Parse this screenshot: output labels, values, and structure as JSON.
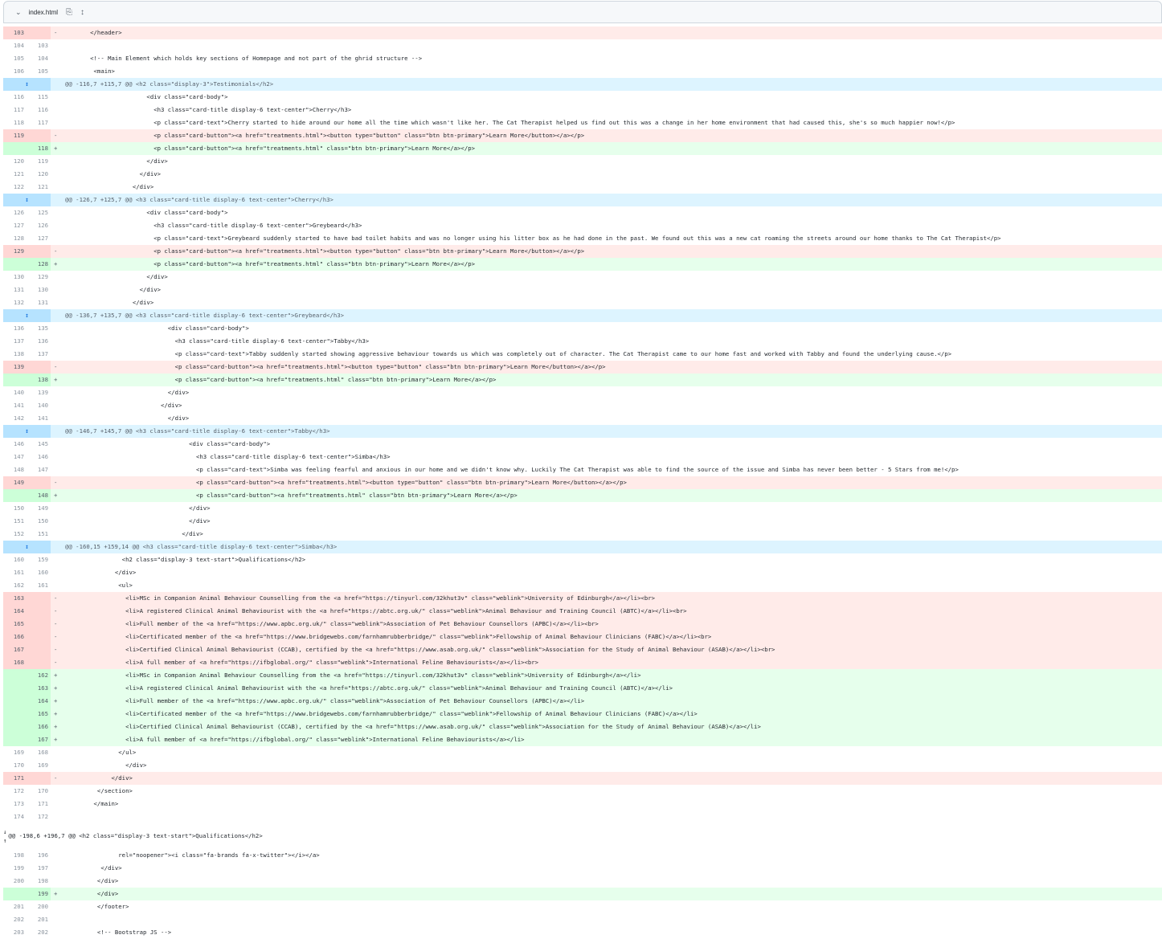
{
  "file": {
    "chevron_icon": "chevron-down-icon",
    "name": "index.html",
    "copy_icon": "copy-icon",
    "expand_icon": "fold-icon"
  },
  "rows": [
    {
      "type": "del",
      "old": "103",
      "new": "",
      "sign": "-",
      "code": "        </header>"
    },
    {
      "type": "ctx",
      "old": "104",
      "new": "103",
      "sign": "",
      "code": ""
    },
    {
      "type": "ctx",
      "old": "105",
      "new": "104",
      "sign": "",
      "code": "        <!-- Main Element which holds key sections of Homepage and not part of the ghrid structure -->"
    },
    {
      "type": "ctx",
      "old": "106",
      "new": "105",
      "sign": "",
      "code": "         <main>"
    },
    {
      "type": "hunk",
      "code": "@@ -116,7 +115,7 @@ <h2 class=\"display-3\">Testimonials</h2>"
    },
    {
      "type": "ctx",
      "old": "116",
      "new": "115",
      "sign": "",
      "code": "                        <div class=\"card-body\">"
    },
    {
      "type": "ctx",
      "old": "117",
      "new": "116",
      "sign": "",
      "code": "                          <h3 class=\"card-title display-6 text-center\">Cherry</h3>"
    },
    {
      "type": "ctx",
      "old": "118",
      "new": "117",
      "sign": "",
      "code": "                          <p class=\"card-text\">Cherry started to hide around our home all the time which wasn't like her. The Cat Therapist helped us find out this was a change in her home environment that had caused this, she's so much happier now!</p>"
    },
    {
      "type": "del",
      "old": "119",
      "new": "",
      "sign": "-",
      "code": "                          <p class=\"card-button\"><a href=\"treatments.html\"><button type=\"button\" class=\"btn btn-primary\">Learn More</button></a></p>"
    },
    {
      "type": "add",
      "old": "",
      "new": "118",
      "sign": "+",
      "code": "                          <p class=\"card-button\"><a href=\"treatments.html\" class=\"btn btn-primary\">Learn More</a></p>"
    },
    {
      "type": "ctx",
      "old": "120",
      "new": "119",
      "sign": "",
      "code": "                        </div>"
    },
    {
      "type": "ctx",
      "old": "121",
      "new": "120",
      "sign": "",
      "code": "                      </div>"
    },
    {
      "type": "ctx",
      "old": "122",
      "new": "121",
      "sign": "",
      "code": "                    </div>"
    },
    {
      "type": "hunk",
      "code": "@@ -126,7 +125,7 @@ <h3 class=\"card-title display-6 text-center\">Cherry</h3>"
    },
    {
      "type": "ctx",
      "old": "126",
      "new": "125",
      "sign": "",
      "code": "                        <div class=\"card-body\">"
    },
    {
      "type": "ctx",
      "old": "127",
      "new": "126",
      "sign": "",
      "code": "                          <h3 class=\"card-title display-6 text-center\">Greybeard</h3>"
    },
    {
      "type": "ctx",
      "old": "128",
      "new": "127",
      "sign": "",
      "code": "                          <p class=\"card-text\">Greybeard suddenly started to have bad toilet habits and was no longer using his litter box as he had done in the past. We found out this was a new cat roaming the streets around our home thanks to The Cat Therapist</p>"
    },
    {
      "type": "del",
      "old": "129",
      "new": "",
      "sign": "-",
      "code": "                          <p class=\"card-button\"><a href=\"treatments.html\"><button type=\"button\" class=\"btn btn-primary\">Learn More</button></a></p>"
    },
    {
      "type": "add",
      "old": "",
      "new": "128",
      "sign": "+",
      "code": "                          <p class=\"card-button\"><a href=\"treatments.html\" class=\"btn btn-primary\">Learn More</a></p>"
    },
    {
      "type": "ctx",
      "old": "130",
      "new": "129",
      "sign": "",
      "code": "                        </div>"
    },
    {
      "type": "ctx",
      "old": "131",
      "new": "130",
      "sign": "",
      "code": "                      </div>"
    },
    {
      "type": "ctx",
      "old": "132",
      "new": "131",
      "sign": "",
      "code": "                    </div>"
    },
    {
      "type": "hunk",
      "code": "@@ -136,7 +135,7 @@ <h3 class=\"card-title display-6 text-center\">Greybeard</h3>"
    },
    {
      "type": "ctx",
      "old": "136",
      "new": "135",
      "sign": "",
      "code": "                              <div class=\"card-body\">"
    },
    {
      "type": "ctx",
      "old": "137",
      "new": "136",
      "sign": "",
      "code": "                                <h3 class=\"card-title display-6 text-center\">Tabby</h3>"
    },
    {
      "type": "ctx",
      "old": "138",
      "new": "137",
      "sign": "",
      "code": "                                <p class=\"card-text\">Tabby suddenly started showing aggressive behaviour towards us which was completely out of character. The Cat Therapist came to our home fast and worked with Tabby and found the underlying cause.</p>"
    },
    {
      "type": "del",
      "old": "139",
      "new": "",
      "sign": "-",
      "code": "                                <p class=\"card-button\"><a href=\"treatments.html\"><button type=\"button\" class=\"btn btn-primary\">Learn More</button></a></p>"
    },
    {
      "type": "add",
      "old": "",
      "new": "138",
      "sign": "+",
      "code": "                                <p class=\"card-button\"><a href=\"treatments.html\" class=\"btn btn-primary\">Learn More</a></p>"
    },
    {
      "type": "ctx",
      "old": "140",
      "new": "139",
      "sign": "",
      "code": "                              </div>"
    },
    {
      "type": "ctx",
      "old": "141",
      "new": "140",
      "sign": "",
      "code": "                            </div>"
    },
    {
      "type": "ctx",
      "old": "142",
      "new": "141",
      "sign": "",
      "code": "                              </div>"
    },
    {
      "type": "hunk",
      "code": "@@ -146,7 +145,7 @@ <h3 class=\"card-title display-6 text-center\">Tabby</h3>"
    },
    {
      "type": "ctx",
      "old": "146",
      "new": "145",
      "sign": "",
      "code": "                                    <div class=\"card-body\">"
    },
    {
      "type": "ctx",
      "old": "147",
      "new": "146",
      "sign": "",
      "code": "                                      <h3 class=\"card-title display-6 text-center\">Simba</h3>"
    },
    {
      "type": "ctx",
      "old": "148",
      "new": "147",
      "sign": "",
      "code": "                                      <p class=\"card-text\">Simba was feeling fearful and anxious in our home and we didn't know why. Luckily The Cat Therapist was able to find the source of the issue and Simba has never been better - 5 Stars from me!</p>"
    },
    {
      "type": "del",
      "old": "149",
      "new": "",
      "sign": "-",
      "code": "                                      <p class=\"card-button\"><a href=\"treatments.html\"><button type=\"button\" class=\"btn btn-primary\">Learn More</button></a></p>"
    },
    {
      "type": "add",
      "old": "",
      "new": "148",
      "sign": "+",
      "code": "                                      <p class=\"card-button\"><a href=\"treatments.html\" class=\"btn btn-primary\">Learn More</a></p>"
    },
    {
      "type": "ctx",
      "old": "150",
      "new": "149",
      "sign": "",
      "code": "                                    </div>"
    },
    {
      "type": "ctx",
      "old": "151",
      "new": "150",
      "sign": "",
      "code": "                                    </div>"
    },
    {
      "type": "ctx",
      "old": "152",
      "new": "151",
      "sign": "",
      "code": "                                  </div>"
    },
    {
      "type": "hunk",
      "code": "@@ -160,15 +159,14 @@ <h3 class=\"card-title display-6 text-center\">Simba</h3>"
    },
    {
      "type": "ctx",
      "old": "160",
      "new": "159",
      "sign": "",
      "code": "                 <h2 class=\"display-3 text-start\">Qualifications</h2>"
    },
    {
      "type": "ctx",
      "old": "161",
      "new": "160",
      "sign": "",
      "code": "               </div>"
    },
    {
      "type": "ctx",
      "old": "162",
      "new": "161",
      "sign": "",
      "code": "                <ul>"
    },
    {
      "type": "del",
      "old": "163",
      "new": "",
      "sign": "-",
      "code": "                  <li>MSc in Companion Animal Behaviour Counselling from the <a href=\"https://tinyurl.com/32khut3v\" class=\"weblink\">University of Edinburgh</a></li><br>"
    },
    {
      "type": "del",
      "old": "164",
      "new": "",
      "sign": "-",
      "code": "                  <li>A registered Clinical Animal Behaviourist with the <a href=\"https://abtc.org.uk/\" class=\"weblink\">Animal Behaviour and Training Council (ABTC)</a></li><br>"
    },
    {
      "type": "del",
      "old": "165",
      "new": "",
      "sign": "-",
      "code": "                  <li>Full member of the <a href=\"https://www.apbc.org.uk/\" class=\"weblink\">Association of Pet Behaviour Counsellors (APBC)</a></li><br>"
    },
    {
      "type": "del",
      "old": "166",
      "new": "",
      "sign": "-",
      "code": "                  <li>Certificated member of the <a href=\"https://www.bridgewebs.com/farnhamrubberbridge/\" class=\"weblink\">Fellowship of Animal Behaviour Clinicians (FABC)</a></li><br>"
    },
    {
      "type": "del",
      "old": "167",
      "new": "",
      "sign": "-",
      "code": "                  <li>Certified Clinical Animal Behaviourist (CCAB), certified by the <a href=\"https://www.asab.org.uk/\" class=\"weblink\">Association for the Study of Animal Behaviour (ASAB)</a></li><br>"
    },
    {
      "type": "del",
      "old": "168",
      "new": "",
      "sign": "-",
      "code": "                  <li>A full member of <a href=\"https://ifbglobal.org/\" class=\"weblink\">International Feline Behaviourists</a></li><br>"
    },
    {
      "type": "add",
      "old": "",
      "new": "162",
      "sign": "+",
      "code": "                  <li>MSc in Companion Animal Behaviour Counselling from the <a href=\"https://tinyurl.com/32khut3v\" class=\"weblink\">University of Edinburgh</a></li>"
    },
    {
      "type": "add",
      "old": "",
      "new": "163",
      "sign": "+",
      "code": "                  <li>A registered Clinical Animal Behaviourist with the <a href=\"https://abtc.org.uk/\" class=\"weblink\">Animal Behaviour and Training Council (ABTC)</a></li>"
    },
    {
      "type": "add",
      "old": "",
      "new": "164",
      "sign": "+",
      "code": "                  <li>Full member of the <a href=\"https://www.apbc.org.uk/\" class=\"weblink\">Association of Pet Behaviour Counsellors (APBC)</a></li>"
    },
    {
      "type": "add",
      "old": "",
      "new": "165",
      "sign": "+",
      "code": "                  <li>Certificated member of the <a href=\"https://www.bridgewebs.com/farnhamrubberbridge/\" class=\"weblink\">Fellowship of Animal Behaviour Clinicians (FABC)</a></li>"
    },
    {
      "type": "add",
      "old": "",
      "new": "166",
      "sign": "+",
      "code": "                  <li>Certified Clinical Animal Behaviourist (CCAB), certified by the <a href=\"https://www.asab.org.uk/\" class=\"weblink\">Association for the Study of Animal Behaviour (ASAB)</a></li>"
    },
    {
      "type": "add",
      "old": "",
      "new": "167",
      "sign": "+",
      "code": "                  <li>A full member of <a href=\"https://ifbglobal.org/\" class=\"weblink\">International Feline Behaviourists</a></li>"
    },
    {
      "type": "ctx",
      "old": "169",
      "new": "168",
      "sign": "",
      "code": "                </ul>"
    },
    {
      "type": "ctx",
      "old": "170",
      "new": "169",
      "sign": "",
      "code": "                  </div>"
    },
    {
      "type": "del",
      "old": "171",
      "new": "",
      "sign": "-",
      "code": "              </div>"
    },
    {
      "type": "ctx",
      "old": "172",
      "new": "170",
      "sign": "",
      "code": "          </section>"
    },
    {
      "type": "ctx",
      "old": "173",
      "new": "171",
      "sign": "",
      "code": "         </main>"
    },
    {
      "type": "ctx",
      "old": "174",
      "new": "172",
      "sign": "",
      "code": ""
    },
    {
      "type": "hunk2",
      "code": "@@ -198,6 +196,7 @@ <h2 class=\"display-3 text-start\">Qualifications</h2>"
    },
    {
      "type": "ctx",
      "old": "198",
      "new": "196",
      "sign": "",
      "code": "                rel=\"noopener\"><i class=\"fa-brands fa-x-twitter\"></i></a>"
    },
    {
      "type": "ctx",
      "old": "199",
      "new": "197",
      "sign": "",
      "code": "           </div>"
    },
    {
      "type": "ctx",
      "old": "200",
      "new": "198",
      "sign": "",
      "code": "          </div>"
    },
    {
      "type": "add",
      "old": "",
      "new": "199",
      "sign": "+",
      "code": "          </div>"
    },
    {
      "type": "ctx",
      "old": "201",
      "new": "200",
      "sign": "",
      "code": "          </footer>"
    },
    {
      "type": "ctx",
      "old": "202",
      "new": "201",
      "sign": "",
      "code": ""
    },
    {
      "type": "ctx",
      "old": "203",
      "new": "202",
      "sign": "",
      "code": "          <!-- Bootstrap JS -->"
    }
  ]
}
